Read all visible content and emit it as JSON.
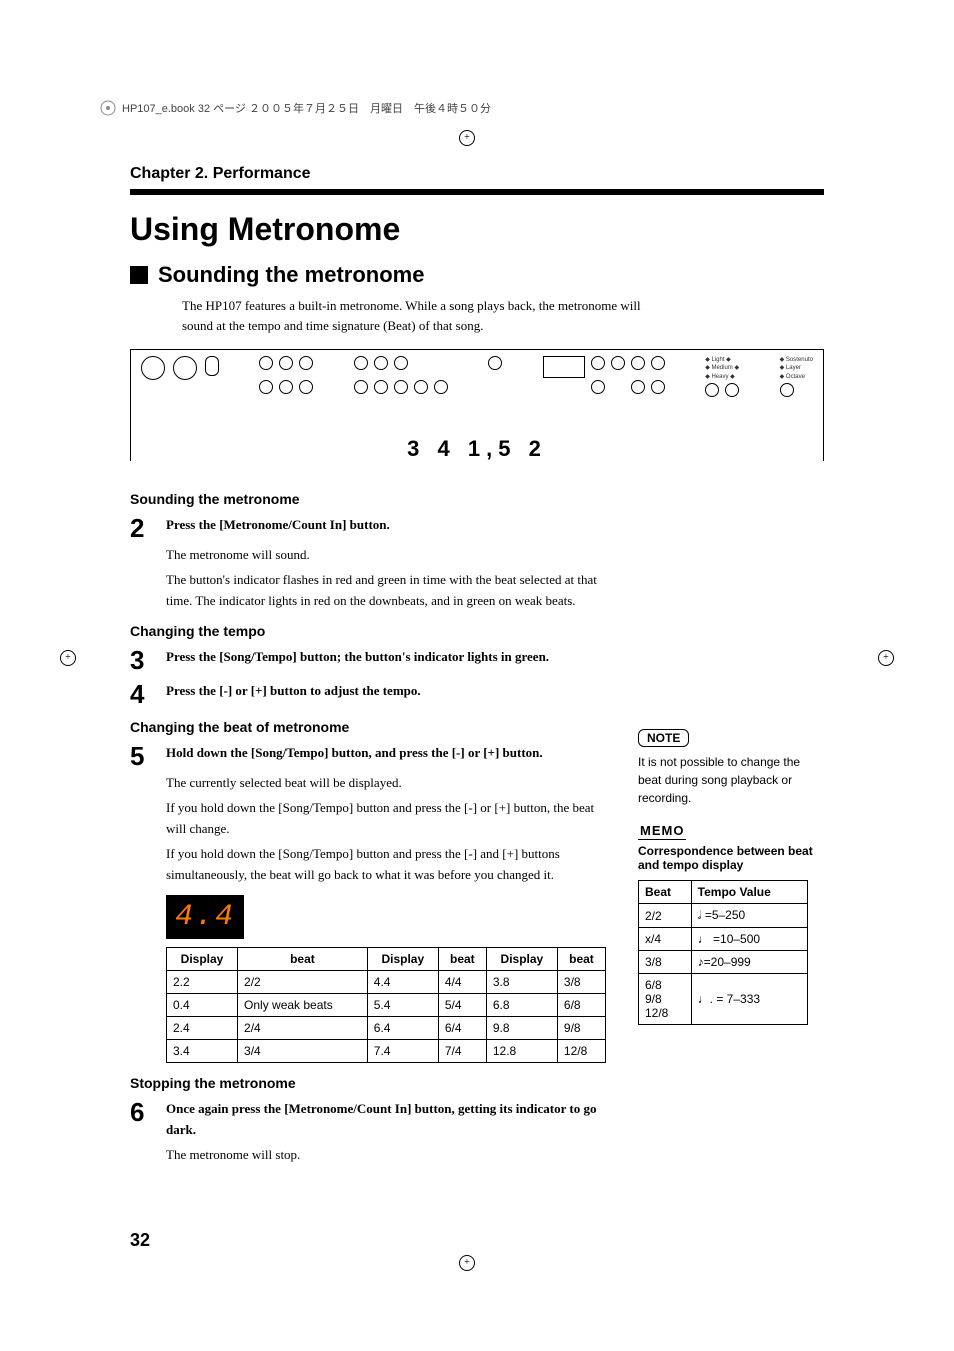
{
  "header": "HP107_e.book 32 ページ ２００５年７月２５日　月曜日　午後４時５０分",
  "chapter": "Chapter 2. Performance",
  "h1": "Using Metronome",
  "h2": "Sounding the metronome",
  "intro": "The HP107 features a built-in metronome. While a song plays back, the metronome will sound at the tempo and time signature (Beat) of that song.",
  "callouts": "3 4 1,5 2",
  "sub1": "Sounding the metronome",
  "step2": {
    "num": "2",
    "lead": "Press the [Metronome/Count In] button.",
    "body1": "The metronome will sound.",
    "body2": "The button's indicator flashes in red and green in time with the beat selected at that time. The indicator lights in red on the downbeats, and in green on weak beats."
  },
  "sub2": "Changing the tempo",
  "step3": {
    "num": "3",
    "lead": "Press the [Song/Tempo] button; the button's indicator lights in green."
  },
  "step4": {
    "num": "4",
    "lead": "Press the [-] or [+] button to adjust the tempo."
  },
  "sub3": "Changing the beat of metronome",
  "step5": {
    "num": "5",
    "lead": "Hold down the [Song/Tempo] button, and press the [-] or [+] button.",
    "body1": "The currently selected beat will be displayed.",
    "body2": "If you hold down the [Song/Tempo] button and press the [-] or [+] button, the beat will change.",
    "body3": "If you hold down the [Song/Tempo] button and press the [-] and [+] buttons simultaneously, the beat will go back to what it was before you changed it."
  },
  "seg": "4.4",
  "beatTable": {
    "headers": [
      "Display",
      "beat",
      "Display",
      "beat",
      "Display",
      "beat"
    ],
    "rows": [
      [
        "2.2",
        "2/2",
        "4.4",
        "4/4",
        "3.8",
        "3/8"
      ],
      [
        "0.4",
        "Only weak beats",
        "5.4",
        "5/4",
        "6.8",
        "6/8"
      ],
      [
        "2.4",
        "2/4",
        "6.4",
        "6/4",
        "9.8",
        "9/8"
      ],
      [
        "3.4",
        "3/4",
        "7.4",
        "7/4",
        "12.8",
        "12/8"
      ]
    ]
  },
  "sub4": "Stopping the metronome",
  "step6": {
    "num": "6",
    "lead": "Once again press the [Metronome/Count In] button, getting its indicator to go dark.",
    "body1": "The metronome will stop."
  },
  "side": {
    "note_label": "NOTE",
    "note_text": "It is not possible to change the beat during song playback or recording.",
    "memo_label": "MEMO",
    "corr": "Correspondence between beat and tempo display",
    "tempoTable": {
      "headers": [
        "Beat",
        "Tempo Value"
      ],
      "rows": [
        [
          "2/2",
          "𝅗𝅥 =5–250"
        ],
        [
          "x/4",
          "♩ =10–500"
        ],
        [
          "3/8",
          "♪=20–999"
        ],
        [
          "6/8\n9/8\n12/8",
          "♩. = 7–333"
        ]
      ]
    }
  },
  "pagenum": "32"
}
